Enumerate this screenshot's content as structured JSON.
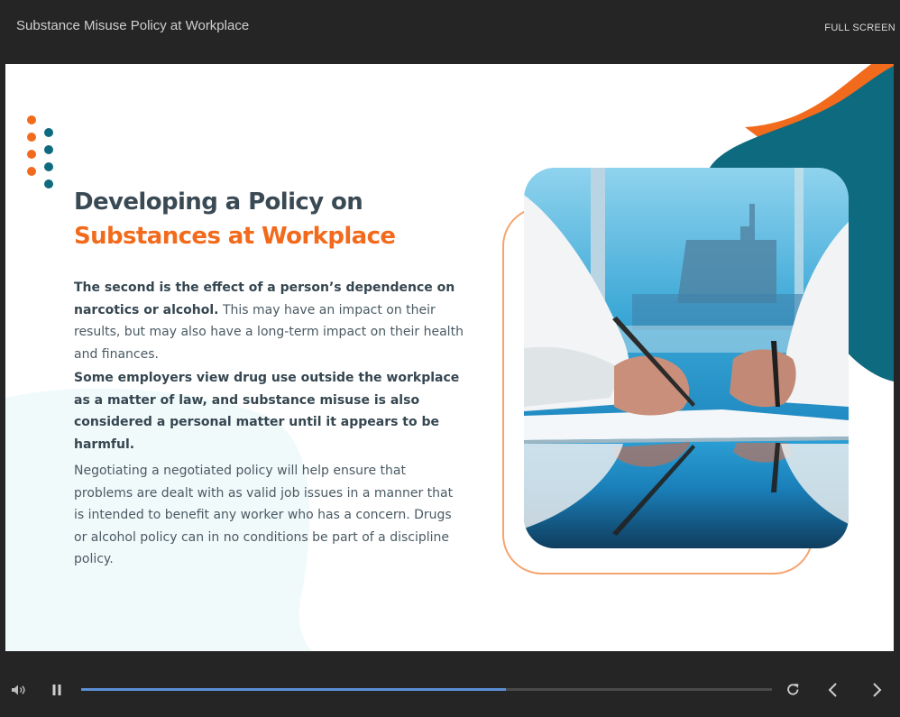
{
  "header": {
    "course_title": "Substance Misuse Policy at Workplace",
    "fullscreen_label": "FULL SCREEN"
  },
  "slide": {
    "heading_line1": "Developing a Policy on",
    "heading_line2": "Substances at Workplace",
    "paragraph1": {
      "bold": "The second is the effect of a person’s dependence on narcotics or alcohol.",
      "normal": " This may have an impact on their results, but may also have a long-term impact on their health and finances."
    },
    "paragraph2": "Some employers view drug use outside the workplace as a matter of law, and substance misuse is also considered a personal matter until it appears to be harmful.",
    "paragraph3": "Negotiating a negotiated policy will help ensure that problems are dealt with as valid job issues in a manner that is intended to benefit any worker who has a concern. Drugs or alcohol policy can in no conditions be part of a discipline policy.",
    "image": "photo-signing-documents"
  },
  "player": {
    "progress": 0.615,
    "icons": [
      "volume-icon",
      "pause-icon",
      "replay-icon",
      "previous-icon",
      "next-icon"
    ]
  },
  "colors": {
    "accent_orange": "#f26b1d",
    "accent_teal": "#0e6a7e",
    "heading_dark": "#3a4a54",
    "progress_blue": "#5b8fd6"
  }
}
